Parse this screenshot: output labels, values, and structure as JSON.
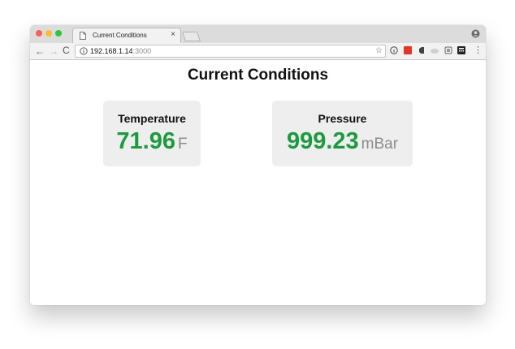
{
  "browser": {
    "tab_title": "Current Conditions",
    "tab_close": "×",
    "url_host": "192.168.1.14",
    "url_port": ":3000",
    "nav": {
      "back": "←",
      "forward": "→",
      "reload": "C"
    },
    "star": "☆",
    "menu": "⋮"
  },
  "page": {
    "title": "Current Conditions",
    "cards": [
      {
        "label": "Temperature",
        "value": "71.96",
        "unit": "F"
      },
      {
        "label": "Pressure",
        "value": "999.23",
        "unit": "mBar"
      }
    ]
  },
  "colors": {
    "value_green": "#1a9c3e",
    "unit_gray": "#8c8c8c",
    "card_bg": "#eeeeee"
  }
}
